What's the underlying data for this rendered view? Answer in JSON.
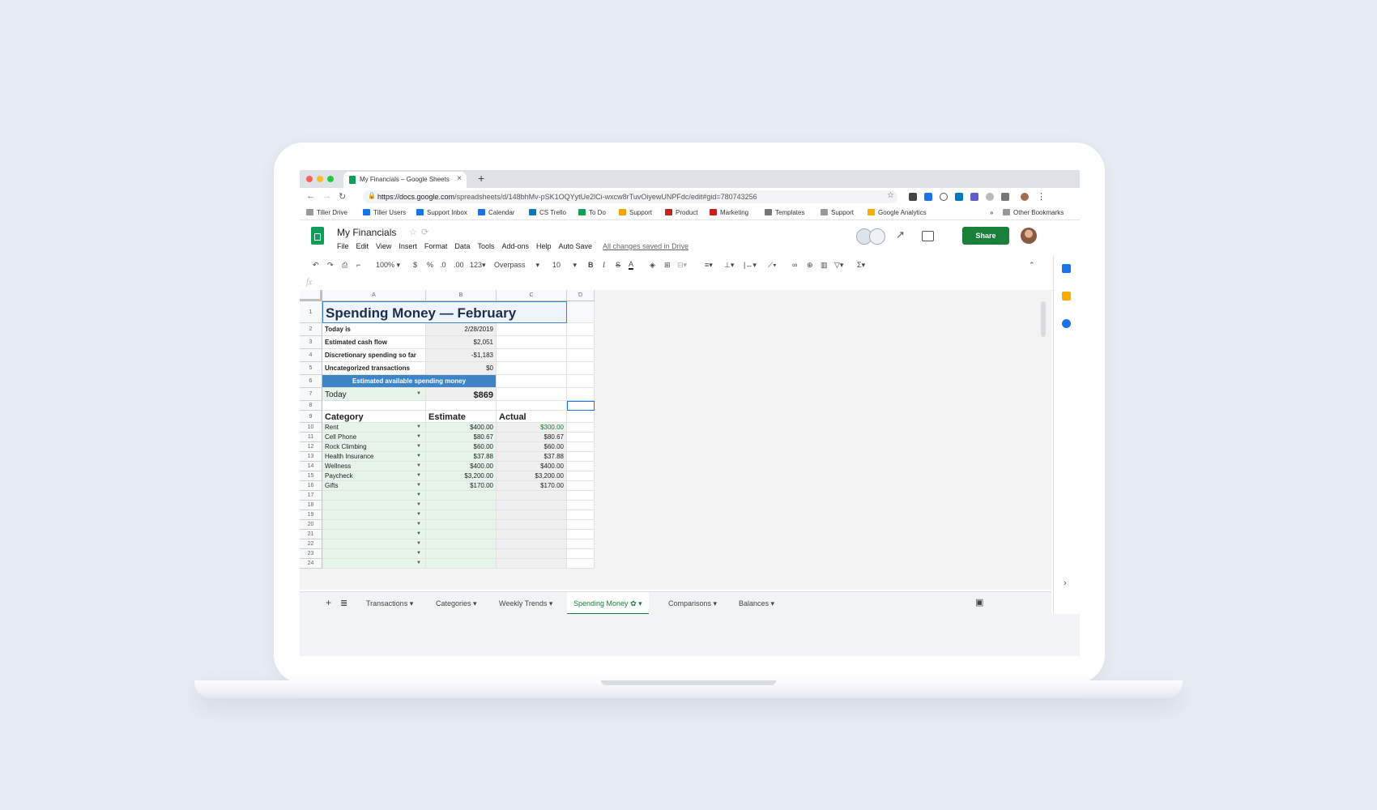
{
  "browser": {
    "tab_title": "My Financials – Google Sheets",
    "url_domain": "https://docs.google.com",
    "url_path": "/spreadsheets/d/148bhMv-pSK1OQYytUe2lCi-wxcw8rTuvOiyewUNPFdc/edit#gid=780743256",
    "bookmarks": [
      "Tiller Drive",
      "Tiller Users",
      "Support Inbox",
      "Calendar",
      "CS Trello",
      "To Do",
      "Support",
      "Product",
      "Marketing",
      "Templates",
      "Support",
      "Google Analytics"
    ],
    "more_bookmarks": "»",
    "other_bookmarks": "Other Bookmarks"
  },
  "sheets": {
    "doc_title": "My Financials",
    "menu": [
      "File",
      "Edit",
      "View",
      "Insert",
      "Format",
      "Data",
      "Tools",
      "Add-ons",
      "Help",
      "Auto Save"
    ],
    "saved_status": "All changes saved in Drive",
    "share_label": "Share"
  },
  "toolbar": {
    "zoom": "100%",
    "currency": "$",
    "percent": "%",
    "dec_less": ".0",
    "dec_more": ".00",
    "more_formats": "123",
    "font": "Overpass",
    "font_size": "10",
    "bold": "B",
    "italic": "I",
    "strike": "S",
    "text_color": "A",
    "functions": "Σ"
  },
  "formula_bar": {
    "fx": "fx"
  },
  "grid": {
    "columns": [
      "A",
      "B",
      "C",
      "D"
    ],
    "rows": [
      "1",
      "2",
      "3",
      "4",
      "5",
      "6",
      "7",
      "8",
      "9",
      "10",
      "11",
      "12",
      "13",
      "14",
      "15",
      "16",
      "17",
      "18",
      "19",
      "20",
      "21",
      "22",
      "23",
      "24"
    ],
    "title": "Spending Money — February",
    "summary": [
      {
        "label": "Today is",
        "value": "2/28/2019"
      },
      {
        "label": "Estimated cash flow",
        "value": "$2,051"
      },
      {
        "label": "Discretionary spending so far",
        "value": "-$1,183"
      },
      {
        "label": "Uncategorized transactions",
        "value": "$0"
      }
    ],
    "banner": "Estimated available spending money",
    "period": "Today",
    "available": "$869",
    "headers": {
      "category": "Category",
      "estimate": "Estimate",
      "actual": "Actual"
    },
    "items": [
      {
        "category": "Rent",
        "estimate": "$400.00",
        "actual": "$300.00"
      },
      {
        "category": "Cell Phone",
        "estimate": "$80.67",
        "actual": "$80.67"
      },
      {
        "category": "Rock Climbing",
        "estimate": "$60.00",
        "actual": "$60.00"
      },
      {
        "category": "Health Insurance",
        "estimate": "$37.88",
        "actual": "$37.88"
      },
      {
        "category": "Wellness",
        "estimate": "$400.00",
        "actual": "$400.00"
      },
      {
        "category": "Paycheck",
        "estimate": "$3,200.00",
        "actual": "$3,200.00"
      },
      {
        "category": "Gifts",
        "estimate": "$170.00",
        "actual": "$170.00"
      }
    ]
  },
  "sheet_tabs": [
    "Transactions",
    "Categories",
    "Weekly Trends",
    "Spending Money",
    "Comparisons",
    "Balances"
  ],
  "colors": {
    "green": "#188038",
    "banner": "#3d85c6",
    "rent_actual": "#188038"
  }
}
